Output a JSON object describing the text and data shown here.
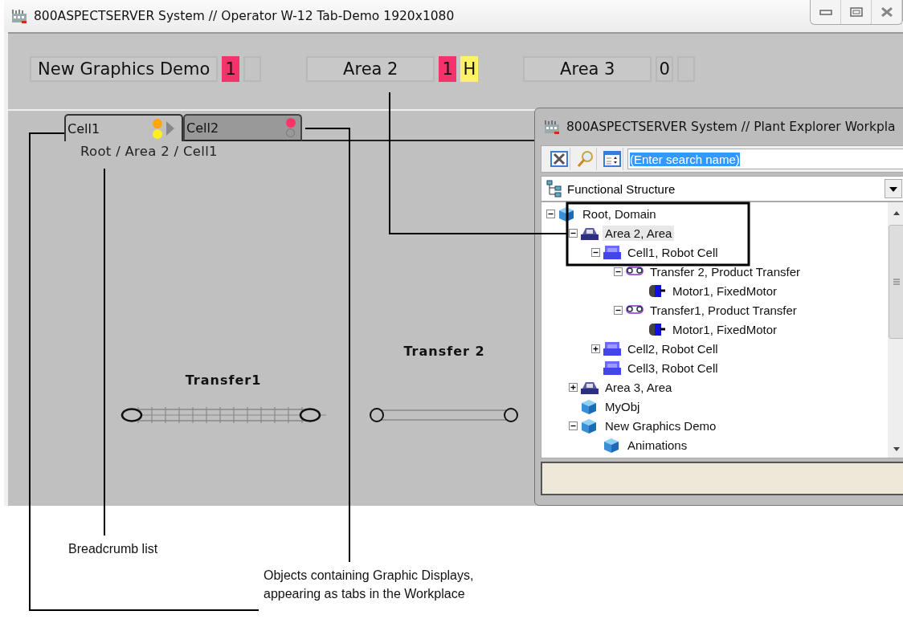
{
  "window": {
    "title": "800ASPECTSERVER System // Operator W-12 Tab-Demo 1920x1080"
  },
  "alarm_band": [
    {
      "label": "New Graphics Demo",
      "badges": [
        {
          "kind": "count",
          "text": "1",
          "color": "#f5336b"
        },
        {
          "kind": "blank"
        }
      ]
    },
    {
      "label": "Area 2",
      "badges": [
        {
          "kind": "count",
          "text": "1",
          "color": "#f5336b"
        },
        {
          "kind": "count",
          "text": "H",
          "color": "#fff266"
        }
      ]
    },
    {
      "label": "Area 3",
      "badges": [
        {
          "kind": "count",
          "text": "0"
        },
        {
          "kind": "blank"
        }
      ]
    }
  ],
  "tabs": [
    {
      "label": "Cell1",
      "selected": true,
      "indicators": [
        {
          "kind": "dot",
          "color": "#ffa60d"
        },
        {
          "kind": "dot",
          "color": "#ffee22"
        }
      ],
      "arrow": true
    },
    {
      "label": "Cell2",
      "selected": false,
      "indicators": [
        {
          "kind": "dot",
          "color": "#ff3366"
        },
        {
          "kind": "ring"
        }
      ],
      "arrow": false
    }
  ],
  "breadcrumb": "Root / Area 2 / Cell1",
  "displays": [
    {
      "label": "Transfer1",
      "kind": "ticked"
    },
    {
      "label": "Transfer 2",
      "kind": "plain"
    }
  ],
  "plant_explorer": {
    "title": "800ASPECTSERVER System // Plant Explorer Workpla",
    "search": {
      "value": "(Enter search name)",
      "highlighted": true
    },
    "structure": "Functional Structure",
    "tree": [
      {
        "label": "Root, Domain",
        "kind": "domain",
        "expanded": true,
        "selected": false,
        "children": [
          {
            "label": "Area 2, Area",
            "kind": "area",
            "expanded": true,
            "selected": true,
            "children": [
              {
                "label": "Cell1, Robot Cell",
                "kind": "cell",
                "expanded": true,
                "selected": false,
                "children": [
                  {
                    "label": "Transfer 2, Product Transfer",
                    "kind": "transfer",
                    "expanded": true,
                    "selected": false,
                    "children": [
                      {
                        "label": "Motor1, FixedMotor",
                        "kind": "motor",
                        "selected": false
                      }
                    ]
                  },
                  {
                    "label": "Transfer1, Product Transfer",
                    "kind": "transfer",
                    "expanded": true,
                    "selected": false,
                    "children": [
                      {
                        "label": "Motor1, FixedMotor",
                        "kind": "motor",
                        "selected": false
                      }
                    ]
                  }
                ]
              },
              {
                "label": "Cell2, Robot Cell",
                "kind": "cell",
                "expanded": false,
                "selected": false
              },
              {
                "label": "Cell3, Robot Cell",
                "kind": "cell",
                "selected": false
              }
            ]
          },
          {
            "label": "Area 3, Area",
            "kind": "area",
            "expanded": false,
            "selected": false
          },
          {
            "label": "MyObj",
            "kind": "domain",
            "selected": false
          },
          {
            "label": "New Graphics Demo",
            "kind": "domain",
            "expanded": true,
            "selected": false,
            "children": [
              {
                "label": "Animations",
                "kind": "domain",
                "selected": false
              }
            ]
          }
        ]
      }
    ]
  },
  "callouts": [
    {
      "text": "Breadcrumb list"
    },
    {
      "text": "Objects containing Graphic Displays, appearing as tabs in the Workplace"
    }
  ]
}
